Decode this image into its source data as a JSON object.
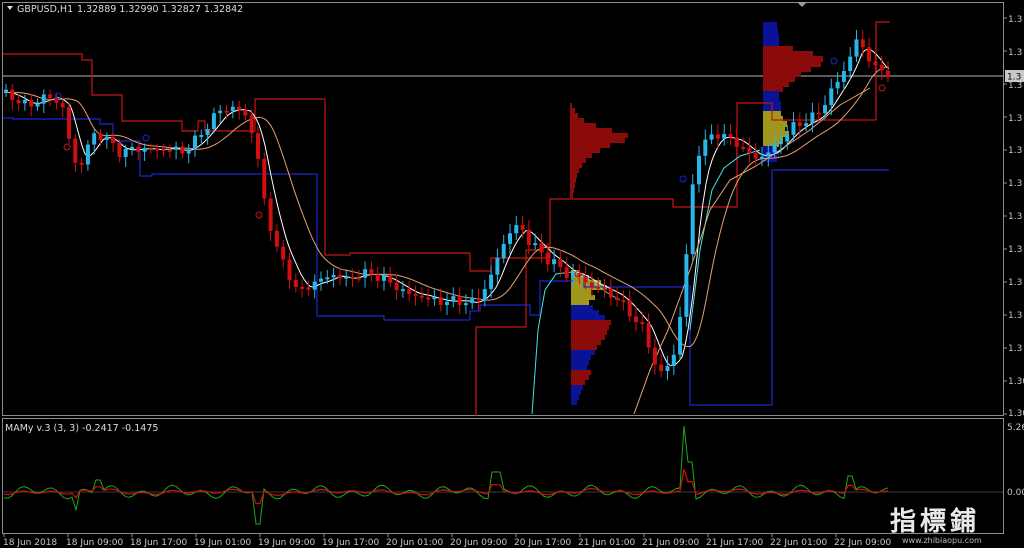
{
  "header": {
    "menu_icon": "triangle-down-icon",
    "symbol": "GBPUSD,H1",
    "ohlc": "1.32889 1.32990 1.32827 1.32842"
  },
  "price_axis": {
    "labels": [
      "1.3",
      "1.3",
      "1.3",
      "1.3",
      "1.3",
      "1.3",
      "1.3",
      "1.3",
      "1.3",
      "1.3",
      "1.3",
      "1.30"
    ],
    "current_label": "1.3"
  },
  "indicator": {
    "title": "MAMy v.3 (3, 3) -0.2417 -0.1475",
    "axis_labels": [
      "5.26",
      "0.00"
    ]
  },
  "time_axis": {
    "labels": [
      "18 Jun 2018",
      "18 Jun 09:00",
      "18 Jun 17:00",
      "19 Jun 01:00",
      "19 Jun 09:00",
      "19 Jun 17:00",
      "20 Jun 01:00",
      "20 Jun 09:00",
      "20 Jun 17:00",
      "21 Jun 01:00",
      "21 Jun 09:00",
      "21 Jun 17:00",
      "22 Jun 01:00",
      "22 Jun 09:00"
    ]
  },
  "watermark": {
    "cn": "指標鋪",
    "url": "www.zhibiaopu.com"
  },
  "colors": {
    "bull": "#29b6e8",
    "bear": "#d01010",
    "channel_red": "#c81414",
    "channel_blue": "#1a28c8",
    "profile_red": "#8b0a0a",
    "profile_blue": "#0a1296",
    "profile_yellow": "#a0961e",
    "ma_fast": "#ffffff",
    "ma_slow": "#e8a070",
    "ma_cyan": "#40e8e0",
    "osc_green": "#1ca81c",
    "osc_red": "#d01010",
    "grid": "#8c8c8c"
  }
}
